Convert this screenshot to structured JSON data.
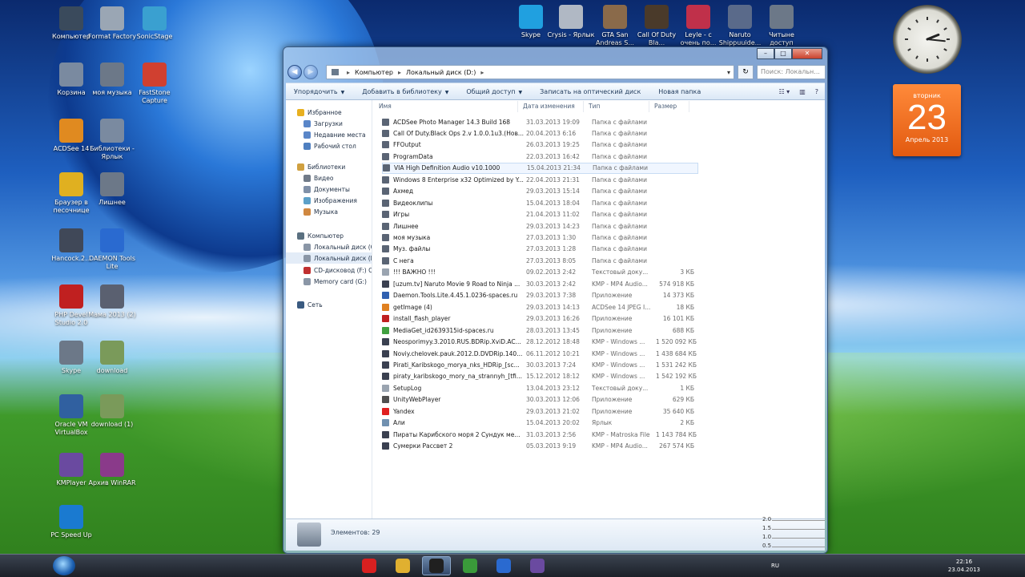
{
  "desktop": {
    "left_icons": [
      {
        "label": "Компьютер",
        "icon": "computer-icon"
      },
      {
        "label": "Format Factory",
        "icon": "format-factory-icon"
      },
      {
        "label": "SonicStage",
        "icon": "sonicstage-icon"
      },
      {
        "label": "Корзина",
        "icon": "recycle-bin-icon"
      },
      {
        "label": "моя музыка",
        "icon": "folder-icon"
      },
      {
        "label": "FastStone Capture",
        "icon": "faststone-icon"
      },
      {
        "label": "ACDSee 14",
        "icon": "acdsee-icon"
      },
      {
        "label": "Библиотеки - Ярлык",
        "icon": "libraries-icon"
      },
      {
        "label": "Браузер в песочнице",
        "icon": "sandbox-browser-icon"
      },
      {
        "label": "Лишнее",
        "icon": "folder-icon"
      },
      {
        "label": "Hancock.2...",
        "icon": "mkv-file-icon"
      },
      {
        "label": "DAEMON Tools Lite",
        "icon": "daemon-tools-icon"
      },
      {
        "label": "PHP Devel Studio 2.0",
        "icon": "php-devel-icon"
      },
      {
        "label": "Мама 2013 (2)",
        "icon": "video-file-icon"
      },
      {
        "label": "Skype",
        "icon": "folder-icon"
      },
      {
        "label": "download",
        "icon": "image-file-icon"
      },
      {
        "label": "Oracle VM VirtualBox",
        "icon": "virtualbox-icon"
      },
      {
        "label": "download (1)",
        "icon": "image-file-icon"
      },
      {
        "label": "KMPlayer",
        "icon": "kmplayer-icon"
      },
      {
        "label": "Архив WinRAR",
        "icon": "winrar-icon"
      },
      {
        "label": "PC Speed Up",
        "icon": "pc-speed-up-icon"
      }
    ],
    "top_icons": [
      {
        "label": "Skype",
        "icon": "skype-icon"
      },
      {
        "label": "Crysis - Ярлык",
        "icon": "crysis-icon"
      },
      {
        "label": "GTA San Andreas S...",
        "icon": "gta-icon"
      },
      {
        "label": "Call Of Duty Bla...",
        "icon": "call-of-duty-icon"
      },
      {
        "label": "Leyle - с очень по...",
        "icon": "mp3-file-icon"
      },
      {
        "label": "Naruto Shippuuide...",
        "icon": "naruto-icon"
      },
      {
        "label": "Читынe доступ",
        "icon": "folder-icon"
      }
    ]
  },
  "gadgets": {
    "clock": {
      "hour": 2,
      "minute": 16
    },
    "calendar": {
      "weekday": "вторник",
      "day": "23",
      "month": "Апрель 2013"
    }
  },
  "window": {
    "caption": {
      "minimize": "–",
      "maximize": "□",
      "close": "✕"
    },
    "address": {
      "root": "Компьютер",
      "current": "Локальный диск (D:)"
    },
    "search_placeholder": "Поиск: Локальн...",
    "toolbar": {
      "organize": "Упорядочить",
      "add_to_library": "Добавить в библиотеку",
      "share": "Общий доступ",
      "burn": "Записать на оптический диск",
      "new_folder": "Новая папка"
    },
    "nav": [
      {
        "label": "Избранное",
        "level": 0,
        "color": "#e8b020"
      },
      {
        "label": "Загрузки",
        "level": 1,
        "color": "#5a86c8"
      },
      {
        "label": "Недавние места",
        "level": 1,
        "color": "#5a86c8"
      },
      {
        "label": "Рабочий стол",
        "level": 1,
        "color": "#4f7fc0"
      },
      {
        "label": "Библиотеки",
        "level": 0,
        "color": "#d0a040"
      },
      {
        "label": "Видео",
        "level": 1,
        "color": "#707a88"
      },
      {
        "label": "Документы",
        "level": 1,
        "color": "#8090a8"
      },
      {
        "label": "Изображения",
        "level": 1,
        "color": "#5ca0c8"
      },
      {
        "label": "Музыка",
        "level": 1,
        "color": "#d08840"
      },
      {
        "label": "Компьютер",
        "level": 0,
        "color": "#5a7080"
      },
      {
        "label": "Локальный диск (C:)",
        "level": 1,
        "color": "#8a96a6"
      },
      {
        "label": "Локальный диск (D:)",
        "level": 1,
        "color": "#8a96a6"
      },
      {
        "label": "CD-дисковод (F:) С...",
        "level": 1,
        "color": "#c03030"
      },
      {
        "label": "Memory card (G:)",
        "level": 1,
        "color": "#8a96a6"
      },
      {
        "label": "Сеть",
        "level": 0,
        "color": "#3a5a80"
      }
    ],
    "columns": {
      "name": "Имя",
      "date": "Дата изменения",
      "type": "Тип",
      "size": "Размер"
    },
    "files": [
      {
        "name": "ACDSee Photo Manager 14.3 Build 168",
        "date": "31.03.2013 19:09",
        "type": "Папка с файлами",
        "size": "",
        "color": "#5a6474"
      },
      {
        "name": "Call Of Duty.Black Ops 2.v 1.0.0.1u3.(Нов...",
        "date": "20.04.2013 6:16",
        "type": "Папка с файлами",
        "size": "",
        "color": "#5a6474"
      },
      {
        "name": "FFOutput",
        "date": "26.03.2013 19:25",
        "type": "Папка с файлами",
        "size": "",
        "color": "#5a6474"
      },
      {
        "name": "ProgramData",
        "date": "22.03.2013 16:42",
        "type": "Папка с файлами",
        "size": "",
        "color": "#5a6474"
      },
      {
        "name": "VIA High Definition Audio v10.1000",
        "date": "15.04.2013 21:34",
        "type": "Папка с файлами",
        "size": "",
        "color": "#5a6474"
      },
      {
        "name": "Windows 8 Enterprise x32 Optimized by Y...",
        "date": "22.04.2013 21:31",
        "type": "Папка с файлами",
        "size": "",
        "color": "#5a6474"
      },
      {
        "name": "Ахмед",
        "date": "29.03.2013 15:14",
        "type": "Папка с файлами",
        "size": "",
        "color": "#5a6474"
      },
      {
        "name": "Видеоклипы",
        "date": "15.04.2013 18:04",
        "type": "Папка с файлами",
        "size": "",
        "color": "#5a6474"
      },
      {
        "name": "Игры",
        "date": "21.04.2013 11:02",
        "type": "Папка с файлами",
        "size": "",
        "color": "#5a6474"
      },
      {
        "name": "Лишнее",
        "date": "29.03.2013 14:23",
        "type": "Папка с файлами",
        "size": "",
        "color": "#5a6474"
      },
      {
        "name": "моя музыка",
        "date": "27.03.2013 1:30",
        "type": "Папка с файлами",
        "size": "",
        "color": "#5a6474"
      },
      {
        "name": "Муз. файлы",
        "date": "27.03.2013 1:28",
        "type": "Папка с файлами",
        "size": "",
        "color": "#5a6474"
      },
      {
        "name": "С нега",
        "date": "27.03.2013 8:05",
        "type": "Папка с файлами",
        "size": "",
        "color": "#5a6474"
      },
      {
        "name": "!!! ВАЖНО !!!",
        "date": "09.02.2013 2:42",
        "type": "Текстовый доку...",
        "size": "3 КБ",
        "color": "#9aa4b0"
      },
      {
        "name": "[uzum.tv] Naruto Movie 9  Road to Ninja ...",
        "date": "30.03.2013 2:42",
        "type": "KMP - MP4 Audio...",
        "size": "574 918 КБ",
        "color": "#3a4050"
      },
      {
        "name": "Daemon.Tools.Lite.4.45.1.0236-spaces.ru",
        "date": "29.03.2013 7:38",
        "type": "Приложение",
        "size": "14 373 КБ",
        "color": "#3060b0"
      },
      {
        "name": "getImage (4)",
        "date": "29.03.2013 14:13",
        "type": "ACDSee 14 JPEG I...",
        "size": "18 КБ",
        "color": "#e08020"
      },
      {
        "name": "install_flash_player",
        "date": "29.03.2013 16:26",
        "type": "Приложение",
        "size": "16 101 КБ",
        "color": "#c02020"
      },
      {
        "name": "MediaGet_id2639315id-spaces.ru",
        "date": "28.03.2013 13:45",
        "type": "Приложение",
        "size": "688 КБ",
        "color": "#40a040"
      },
      {
        "name": "Neosporimyy.3.2010.RUS.BDRip.XviD.AC...",
        "date": "28.12.2012 18:48",
        "type": "KMP - Windows ...",
        "size": "1 520 092 КБ",
        "color": "#3a4050"
      },
      {
        "name": "Noviy.chelovek.pauk.2012.D.DVDRip.140...",
        "date": "06.11.2012 10:21",
        "type": "KMP - Windows ...",
        "size": "1 438 684 КБ",
        "color": "#3a4050"
      },
      {
        "name": "Pirati_Karibskogo_morya_nks_HDRip_[sc...",
        "date": "30.03.2013 7:24",
        "type": "KMP - Windows ...",
        "size": "1 531 242 КБ",
        "color": "#3a4050"
      },
      {
        "name": "piraty_karibskogo_mory_na_strannyh_[tfi...",
        "date": "15.12.2012 18:12",
        "type": "KMP - Windows ...",
        "size": "1 542 192 КБ",
        "color": "#3a4050"
      },
      {
        "name": "SetupLog",
        "date": "13.04.2013 23:12",
        "type": "Текстовый доку...",
        "size": "1 КБ",
        "color": "#9aa4b0"
      },
      {
        "name": "UnityWebPlayer",
        "date": "30.03.2013 12:06",
        "type": "Приложение",
        "size": "629 КБ",
        "color": "#505050"
      },
      {
        "name": "Yandex",
        "date": "29.03.2013 21:02",
        "type": "Приложение",
        "size": "35 640 КБ",
        "color": "#e02020"
      },
      {
        "name": "Али",
        "date": "15.04.2013 20:02",
        "type": "Ярлык",
        "size": "2 КБ",
        "color": "#7090b0"
      },
      {
        "name": "Пираты Карибского моря 2 Сундук ме...",
        "date": "31.03.2013 2:56",
        "type": "KMP - Matroska File",
        "size": "1 143 784 КБ",
        "color": "#3a4050"
      },
      {
        "name": "Сумерки Рассвет 2",
        "date": "05.03.2013 9:19",
        "type": "KMP - MP4 Audio...",
        "size": "267 574 КБ",
        "color": "#3a4050"
      }
    ],
    "highlighted_row": 4,
    "status": "Элементов: 29"
  },
  "meter": {
    "labels": [
      "2.0",
      "1.5",
      "1.0",
      "0.5"
    ]
  },
  "taskbar": {
    "apps": [
      "yandex-icon",
      "explorer-icon",
      "terminal-icon",
      "chrome-icon",
      "media-player-icon",
      "kmplayer-icon"
    ],
    "lang": "RU",
    "time": "22:16",
    "date": "23.04.2013"
  }
}
